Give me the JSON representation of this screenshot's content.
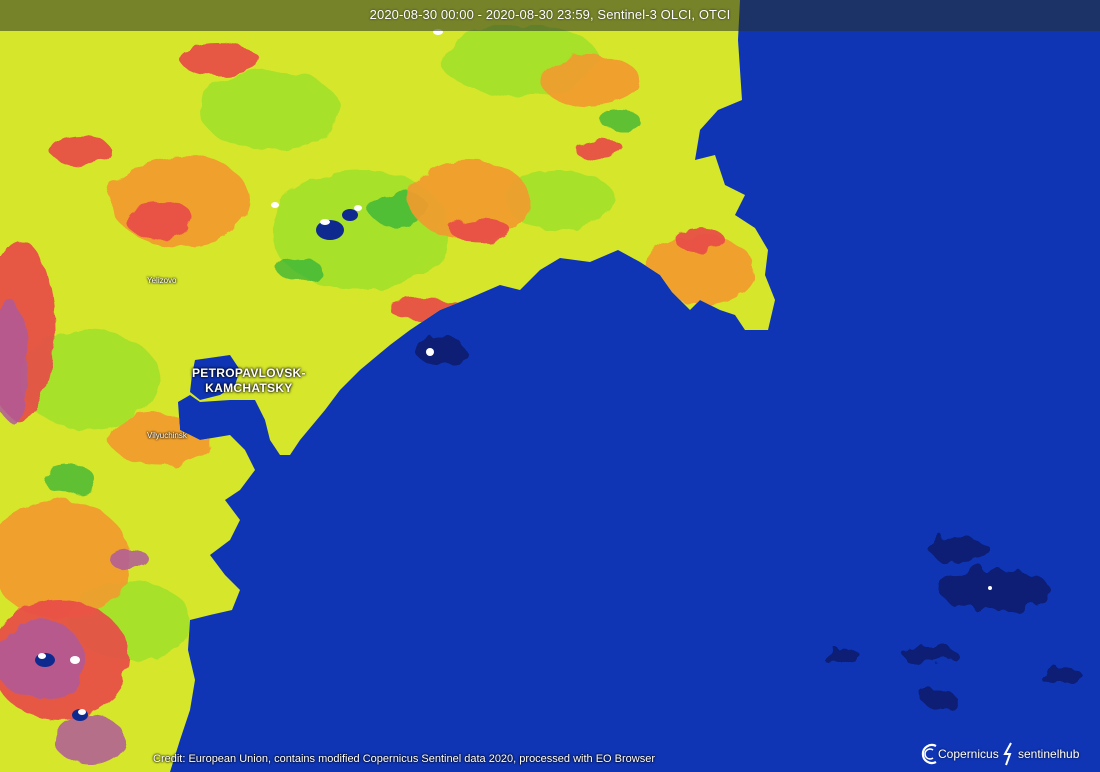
{
  "header": {
    "title": "2020-08-30 00:00 - 2020-08-30 23:59, Sentinel-3 OLCI, OTCI"
  },
  "map": {
    "ocean_color": "#0f35b5",
    "land_colors": [
      "#d8e82a",
      "#9fe02a",
      "#f39a2e",
      "#e84a48",
      "#b05a9a",
      "#2db03a"
    ],
    "labels": {
      "yelizovo": "Yelizovo",
      "city_line1": "PETROPAVLOVSK-",
      "city_line2": "KAMCHATSKY",
      "vilyuchinsk": "Vilyuchinsk"
    }
  },
  "footer": {
    "credit": "Credit: European Union, contains modified Copernicus Sentinel data 2020, processed with EO Browser",
    "logo_copernicus": "Copernicus",
    "logo_sentinelhub": "sentinelhub"
  }
}
